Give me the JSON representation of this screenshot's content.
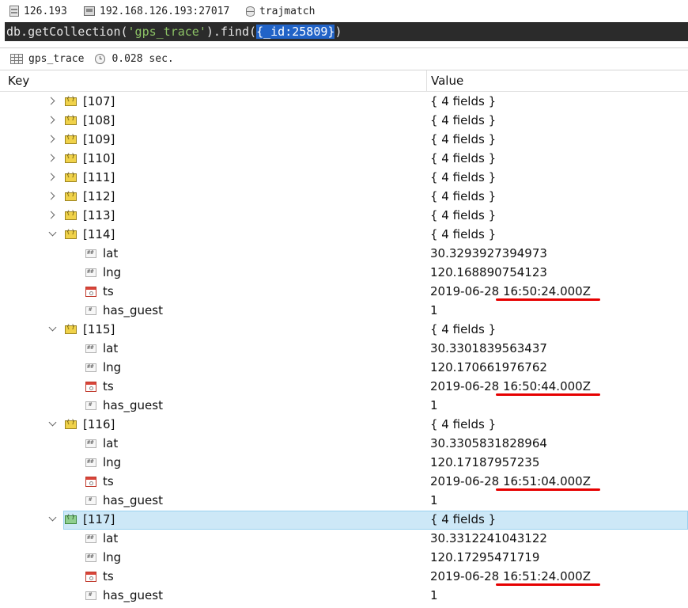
{
  "connection": {
    "server": "126.193",
    "host": "192.168.126.193:27017",
    "database": "trajmatch"
  },
  "query": {
    "prefix": "db.getCollection(",
    "collection": "'gps_trace'",
    "middle": ").find(",
    "selected": "{_id:25809}",
    "suffix": ")"
  },
  "result": {
    "collection": "gps_trace",
    "time": "0.028 sec."
  },
  "grid": {
    "key_header": "Key",
    "value_header": "Value"
  },
  "rows": [
    {
      "key": "[107]",
      "value": "{ 4 fields }",
      "type": "object",
      "expanded": false
    },
    {
      "key": "[108]",
      "value": "{ 4 fields }",
      "type": "object",
      "expanded": false
    },
    {
      "key": "[109]",
      "value": "{ 4 fields }",
      "type": "object",
      "expanded": false
    },
    {
      "key": "[110]",
      "value": "{ 4 fields }",
      "type": "object",
      "expanded": false
    },
    {
      "key": "[111]",
      "value": "{ 4 fields }",
      "type": "object",
      "expanded": false
    },
    {
      "key": "[112]",
      "value": "{ 4 fields }",
      "type": "object",
      "expanded": false
    },
    {
      "key": "[113]",
      "value": "{ 4 fields }",
      "type": "object",
      "expanded": false
    },
    {
      "key": "[114]",
      "value": "{ 4 fields }",
      "type": "object",
      "expanded": true
    },
    {
      "key": "lat",
      "value": "30.3293927394973",
      "type": "double"
    },
    {
      "key": "lng",
      "value": "120.168890754123",
      "type": "double"
    },
    {
      "key": "ts",
      "value": "2019-06-28 16:50:24.000Z",
      "type": "date",
      "underlined": true
    },
    {
      "key": "has_guest",
      "value": "1",
      "type": "int"
    },
    {
      "key": "[115]",
      "value": "{ 4 fields }",
      "type": "object",
      "expanded": true
    },
    {
      "key": "lat",
      "value": "30.3301839563437",
      "type": "double"
    },
    {
      "key": "lng",
      "value": "120.170661976762",
      "type": "double"
    },
    {
      "key": "ts",
      "value": "2019-06-28 16:50:44.000Z",
      "type": "date",
      "underlined": true
    },
    {
      "key": "has_guest",
      "value": "1",
      "type": "int"
    },
    {
      "key": "[116]",
      "value": "{ 4 fields }",
      "type": "object",
      "expanded": true
    },
    {
      "key": "lat",
      "value": "30.3305831828964",
      "type": "double"
    },
    {
      "key": "lng",
      "value": "120.17187957235",
      "type": "double"
    },
    {
      "key": "ts",
      "value": "2019-06-28 16:51:04.000Z",
      "type": "date",
      "underlined": true
    },
    {
      "key": "has_guest",
      "value": "1",
      "type": "int"
    },
    {
      "key": "[117]",
      "value": "{ 4 fields }",
      "type": "object",
      "expanded": true,
      "selected": true
    },
    {
      "key": "lat",
      "value": "30.3312241043122",
      "type": "double"
    },
    {
      "key": "lng",
      "value": "120.17295471719",
      "type": "double"
    },
    {
      "key": "ts",
      "value": "2019-06-28 16:51:24.000Z",
      "type": "date",
      "underlined": true
    },
    {
      "key": "has_guest",
      "value": "1",
      "type": "int"
    }
  ],
  "colors": {
    "query_bg": "#2b2b2b",
    "string_literal": "#8cc265",
    "selection": "#2163c7",
    "row_selected": "#cde8f7",
    "annotation": "#e60000"
  }
}
